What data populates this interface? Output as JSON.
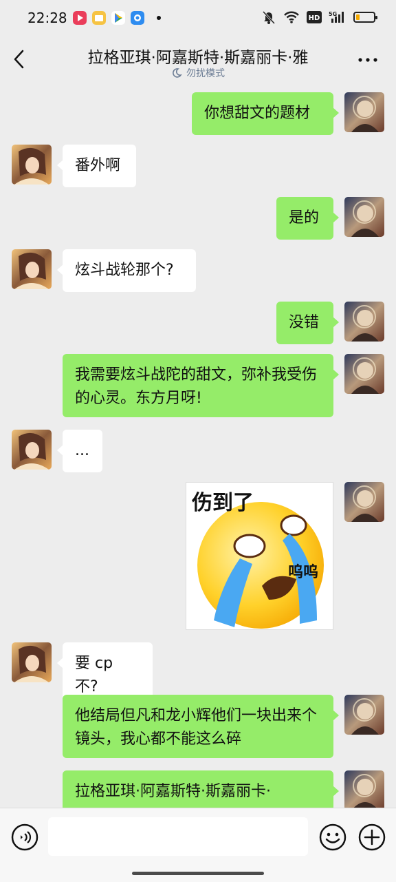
{
  "status_bar": {
    "time": "22:28",
    "network": "5G",
    "hd": "HD",
    "battery_level": 0.2,
    "app_icons": [
      "video-app-icon",
      "mail-app-icon",
      "play-store-icon",
      "browser-app-icon"
    ]
  },
  "header": {
    "title": "拉格亚琪·阿嘉斯特·斯嘉丽卡·雅",
    "dnd_label": "勿扰模式",
    "more_label": "···"
  },
  "messages": [
    {
      "side": "out",
      "text": "你想甜文的题材"
    },
    {
      "side": "in",
      "text": "番外啊"
    },
    {
      "side": "out",
      "text": "是的"
    },
    {
      "side": "in",
      "text": "炫斗战轮那个?"
    },
    {
      "side": "out",
      "text": "没错"
    },
    {
      "side": "out",
      "text": "我需要炫斗战陀的甜文，弥补我受伤的心灵。东方月呀!"
    },
    {
      "side": "in",
      "text": "..."
    },
    {
      "side": "out",
      "type": "sticker",
      "caption": "伤到了",
      "subcaption": "呜呜"
    },
    {
      "side": "in",
      "text": "要 cp 不?"
    },
    {
      "side": "out",
      "text": "他结局但凡和龙小辉他们一块出来个镜头，我心都不能这么碎"
    },
    {
      "side": "out",
      "text": "拉格亚琪·阿嘉斯特·斯嘉丽卡·"
    }
  ],
  "input_bar": {
    "placeholder": ""
  },
  "colors": {
    "background": "#ededed",
    "outgoing_bubble": "#95ec69",
    "incoming_bubble": "#ffffff",
    "dnd_text": "#6b7c94"
  }
}
